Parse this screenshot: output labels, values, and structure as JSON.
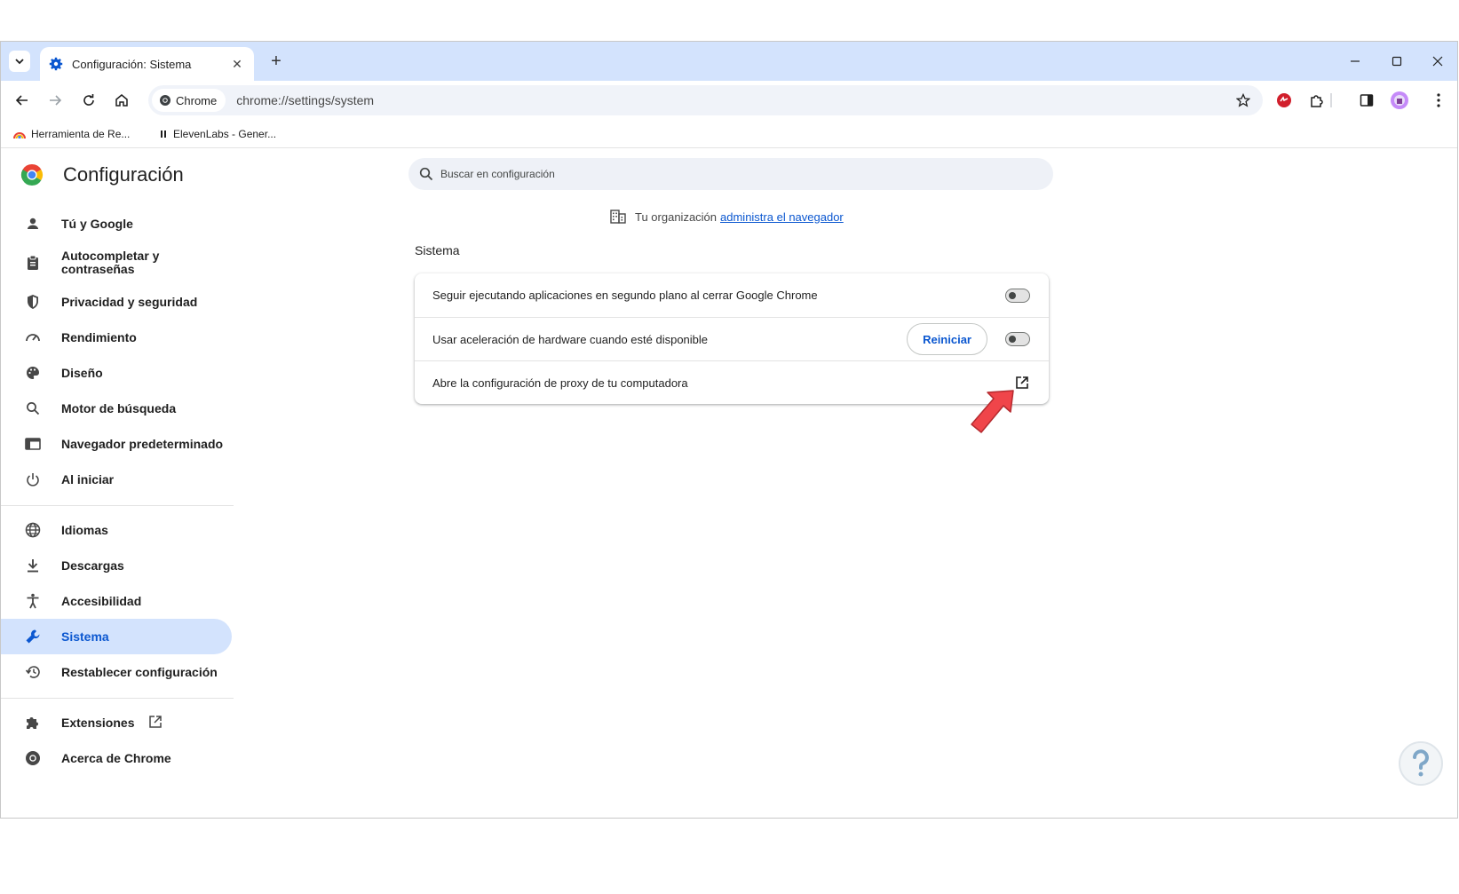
{
  "tab": {
    "title": "Configuración: Sistema"
  },
  "omnibox": {
    "chip_label": "Chrome",
    "url": "chrome://settings/system"
  },
  "bookmarks": [
    {
      "label": "Herramienta de Re..."
    },
    {
      "label": "ElevenLabs - Gener..."
    }
  ],
  "settings": {
    "title": "Configuración",
    "search_placeholder": "Buscar en configuración",
    "menu_group1": [
      {
        "label": "Tú y Google",
        "icon": "person-icon"
      },
      {
        "label": "Autocompletar y contraseñas",
        "icon": "clipboard-icon"
      },
      {
        "label": "Privacidad y seguridad",
        "icon": "shield-icon"
      },
      {
        "label": "Rendimiento",
        "icon": "speedometer-icon"
      },
      {
        "label": "Diseño",
        "icon": "palette-icon"
      },
      {
        "label": "Motor de búsqueda",
        "icon": "search-icon"
      },
      {
        "label": "Navegador predeterminado",
        "icon": "browser-icon"
      },
      {
        "label": "Al iniciar",
        "icon": "power-icon"
      }
    ],
    "menu_group2": [
      {
        "label": "Idiomas",
        "icon": "globe-icon"
      },
      {
        "label": "Descargas",
        "icon": "download-icon"
      },
      {
        "label": "Accesibilidad",
        "icon": "accessibility-icon"
      },
      {
        "label": "Sistema",
        "icon": "wrench-icon",
        "active": true
      },
      {
        "label": "Restablecer configuración",
        "icon": "history-icon"
      }
    ],
    "menu_group3": [
      {
        "label": "Extensiones",
        "icon": "puzzle-icon"
      },
      {
        "label": "Acerca de Chrome",
        "icon": "chrome-icon"
      }
    ],
    "managed_prefix": "Tu organización",
    "managed_link": "administra el navegador",
    "section_title": "Sistema",
    "rows": {
      "background_apps": {
        "label": "Seguir ejecutando aplicaciones en segundo plano al cerrar Google Chrome",
        "enabled": false
      },
      "hardware_accel": {
        "label": "Usar aceleración de hardware cuando esté disponible",
        "enabled": false,
        "button_label": "Reiniciar"
      },
      "proxy": {
        "label": "Abre la configuración de proxy de tu computadora"
      }
    }
  },
  "colors": {
    "accent": "#0b57d0",
    "active_bg": "#d3e3fd",
    "arrow": "#f0454a"
  }
}
